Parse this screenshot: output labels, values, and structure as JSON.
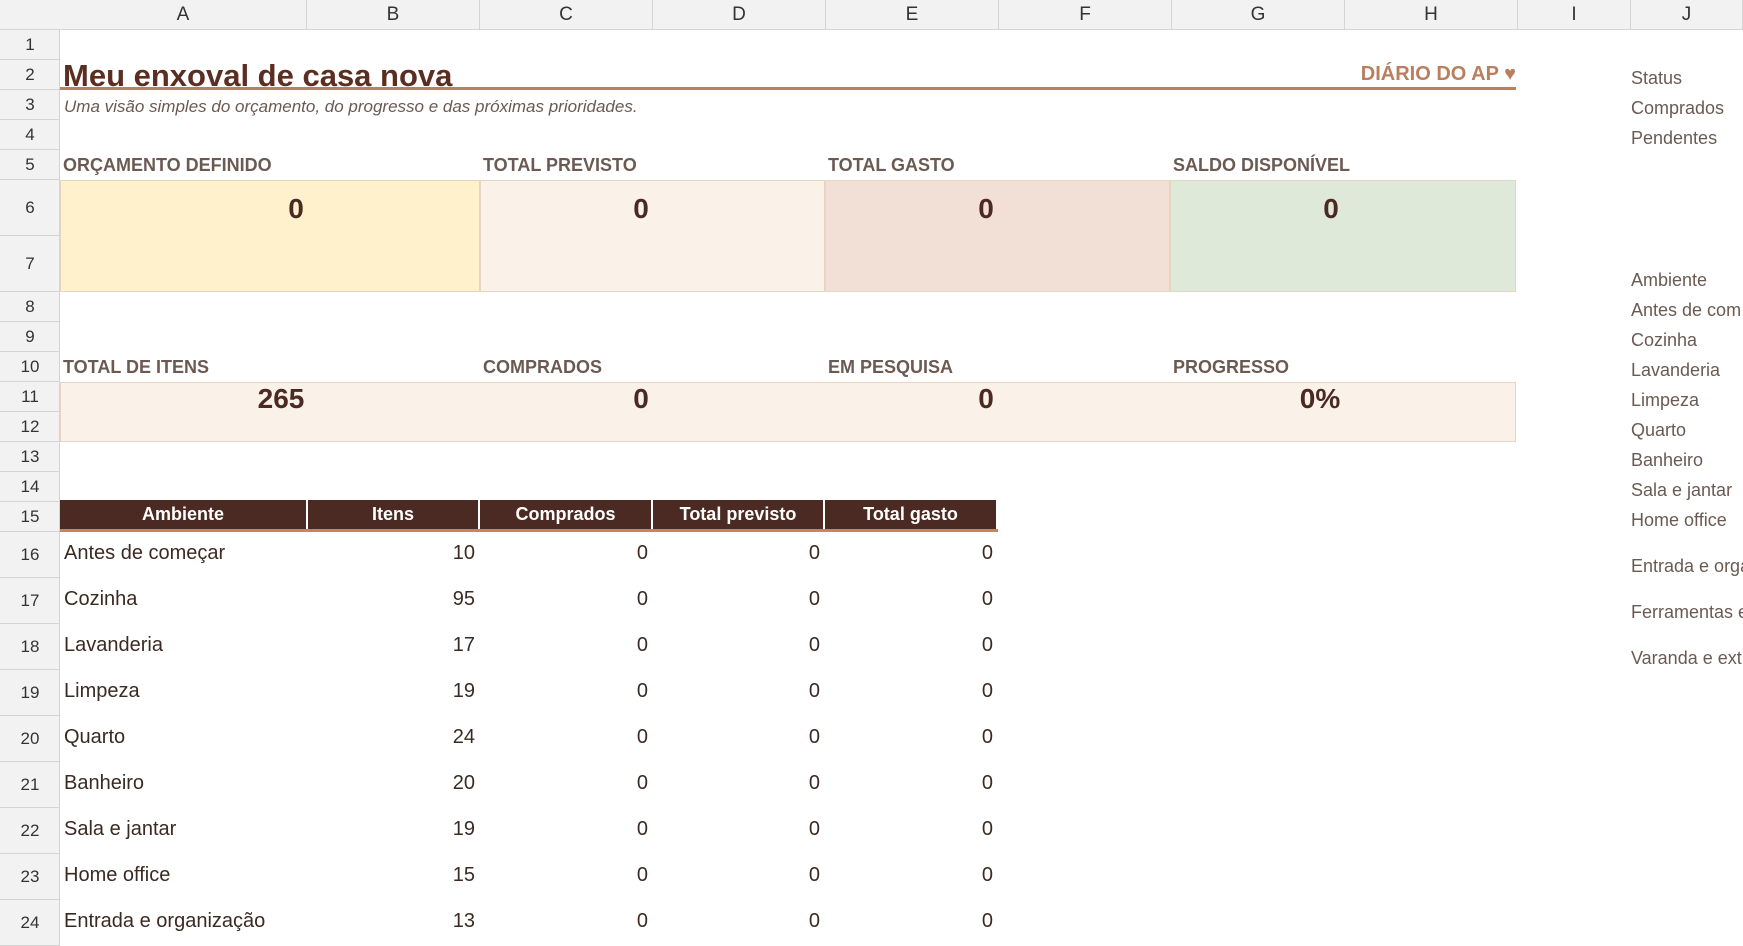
{
  "columns": [
    "A",
    "B",
    "C",
    "D",
    "E",
    "F",
    "G",
    "H",
    "I",
    "J"
  ],
  "rows": [
    "1",
    "2",
    "3",
    "4",
    "5",
    "6",
    "7",
    "8",
    "9",
    "10",
    "11",
    "12",
    "13",
    "14",
    "15",
    "16",
    "17",
    "18",
    "19",
    "20",
    "21",
    "22",
    "23",
    "24"
  ],
  "header": {
    "title": "Meu enxoval de casa nova",
    "brand": "DIÁRIO DO AP ♥",
    "subtitle": "Uma visão simples do orçamento, do progresso e das próximas prioridades."
  },
  "budget_cards": [
    {
      "label": "ORÇAMENTO DEFINIDO",
      "value": "0",
      "color": "#fff1cc"
    },
    {
      "label": "TOTAL PREVISTO",
      "value": "0",
      "color": "#faf1e9"
    },
    {
      "label": "TOTAL GASTO",
      "value": "0",
      "color": "#f2dfd5"
    },
    {
      "label": "SALDO DISPONÍVEL",
      "value": "0",
      "color": "#dfe9d9"
    }
  ],
  "progress_cards": [
    {
      "label": "TOTAL DE ITENS",
      "value": "265"
    },
    {
      "label": "COMPRADOS",
      "value": "0"
    },
    {
      "label": "EM PESQUISA",
      "value": "0"
    },
    {
      "label": "PROGRESSO",
      "value": "0%"
    }
  ],
  "table": {
    "headers": [
      "Ambiente",
      "Itens",
      "Comprados",
      "Total previsto",
      "Total gasto"
    ],
    "rows": [
      [
        "Antes de começar",
        "10",
        "0",
        "0",
        "0"
      ],
      [
        "Cozinha",
        "95",
        "0",
        "0",
        "0"
      ],
      [
        "Lavanderia",
        "17",
        "0",
        "0",
        "0"
      ],
      [
        "Limpeza",
        "19",
        "0",
        "0",
        "0"
      ],
      [
        "Quarto",
        "24",
        "0",
        "0",
        "0"
      ],
      [
        "Banheiro",
        "20",
        "0",
        "0",
        "0"
      ],
      [
        "Sala e jantar",
        "19",
        "0",
        "0",
        "0"
      ],
      [
        "Home office",
        "15",
        "0",
        "0",
        "0"
      ],
      [
        "Entrada e organização",
        "13",
        "0",
        "0",
        "0"
      ]
    ]
  },
  "side_status": [
    "Status",
    "Comprados",
    "Pendentes"
  ],
  "side_ambientes": [
    "Ambiente",
    "Antes de com",
    "Cozinha",
    "Lavanderia",
    "Limpeza",
    "Quarto",
    "Banheiro",
    "Sala e jantar",
    "Home office",
    "Entrada e orga",
    "Ferramentas e",
    "Varanda e ext"
  ]
}
